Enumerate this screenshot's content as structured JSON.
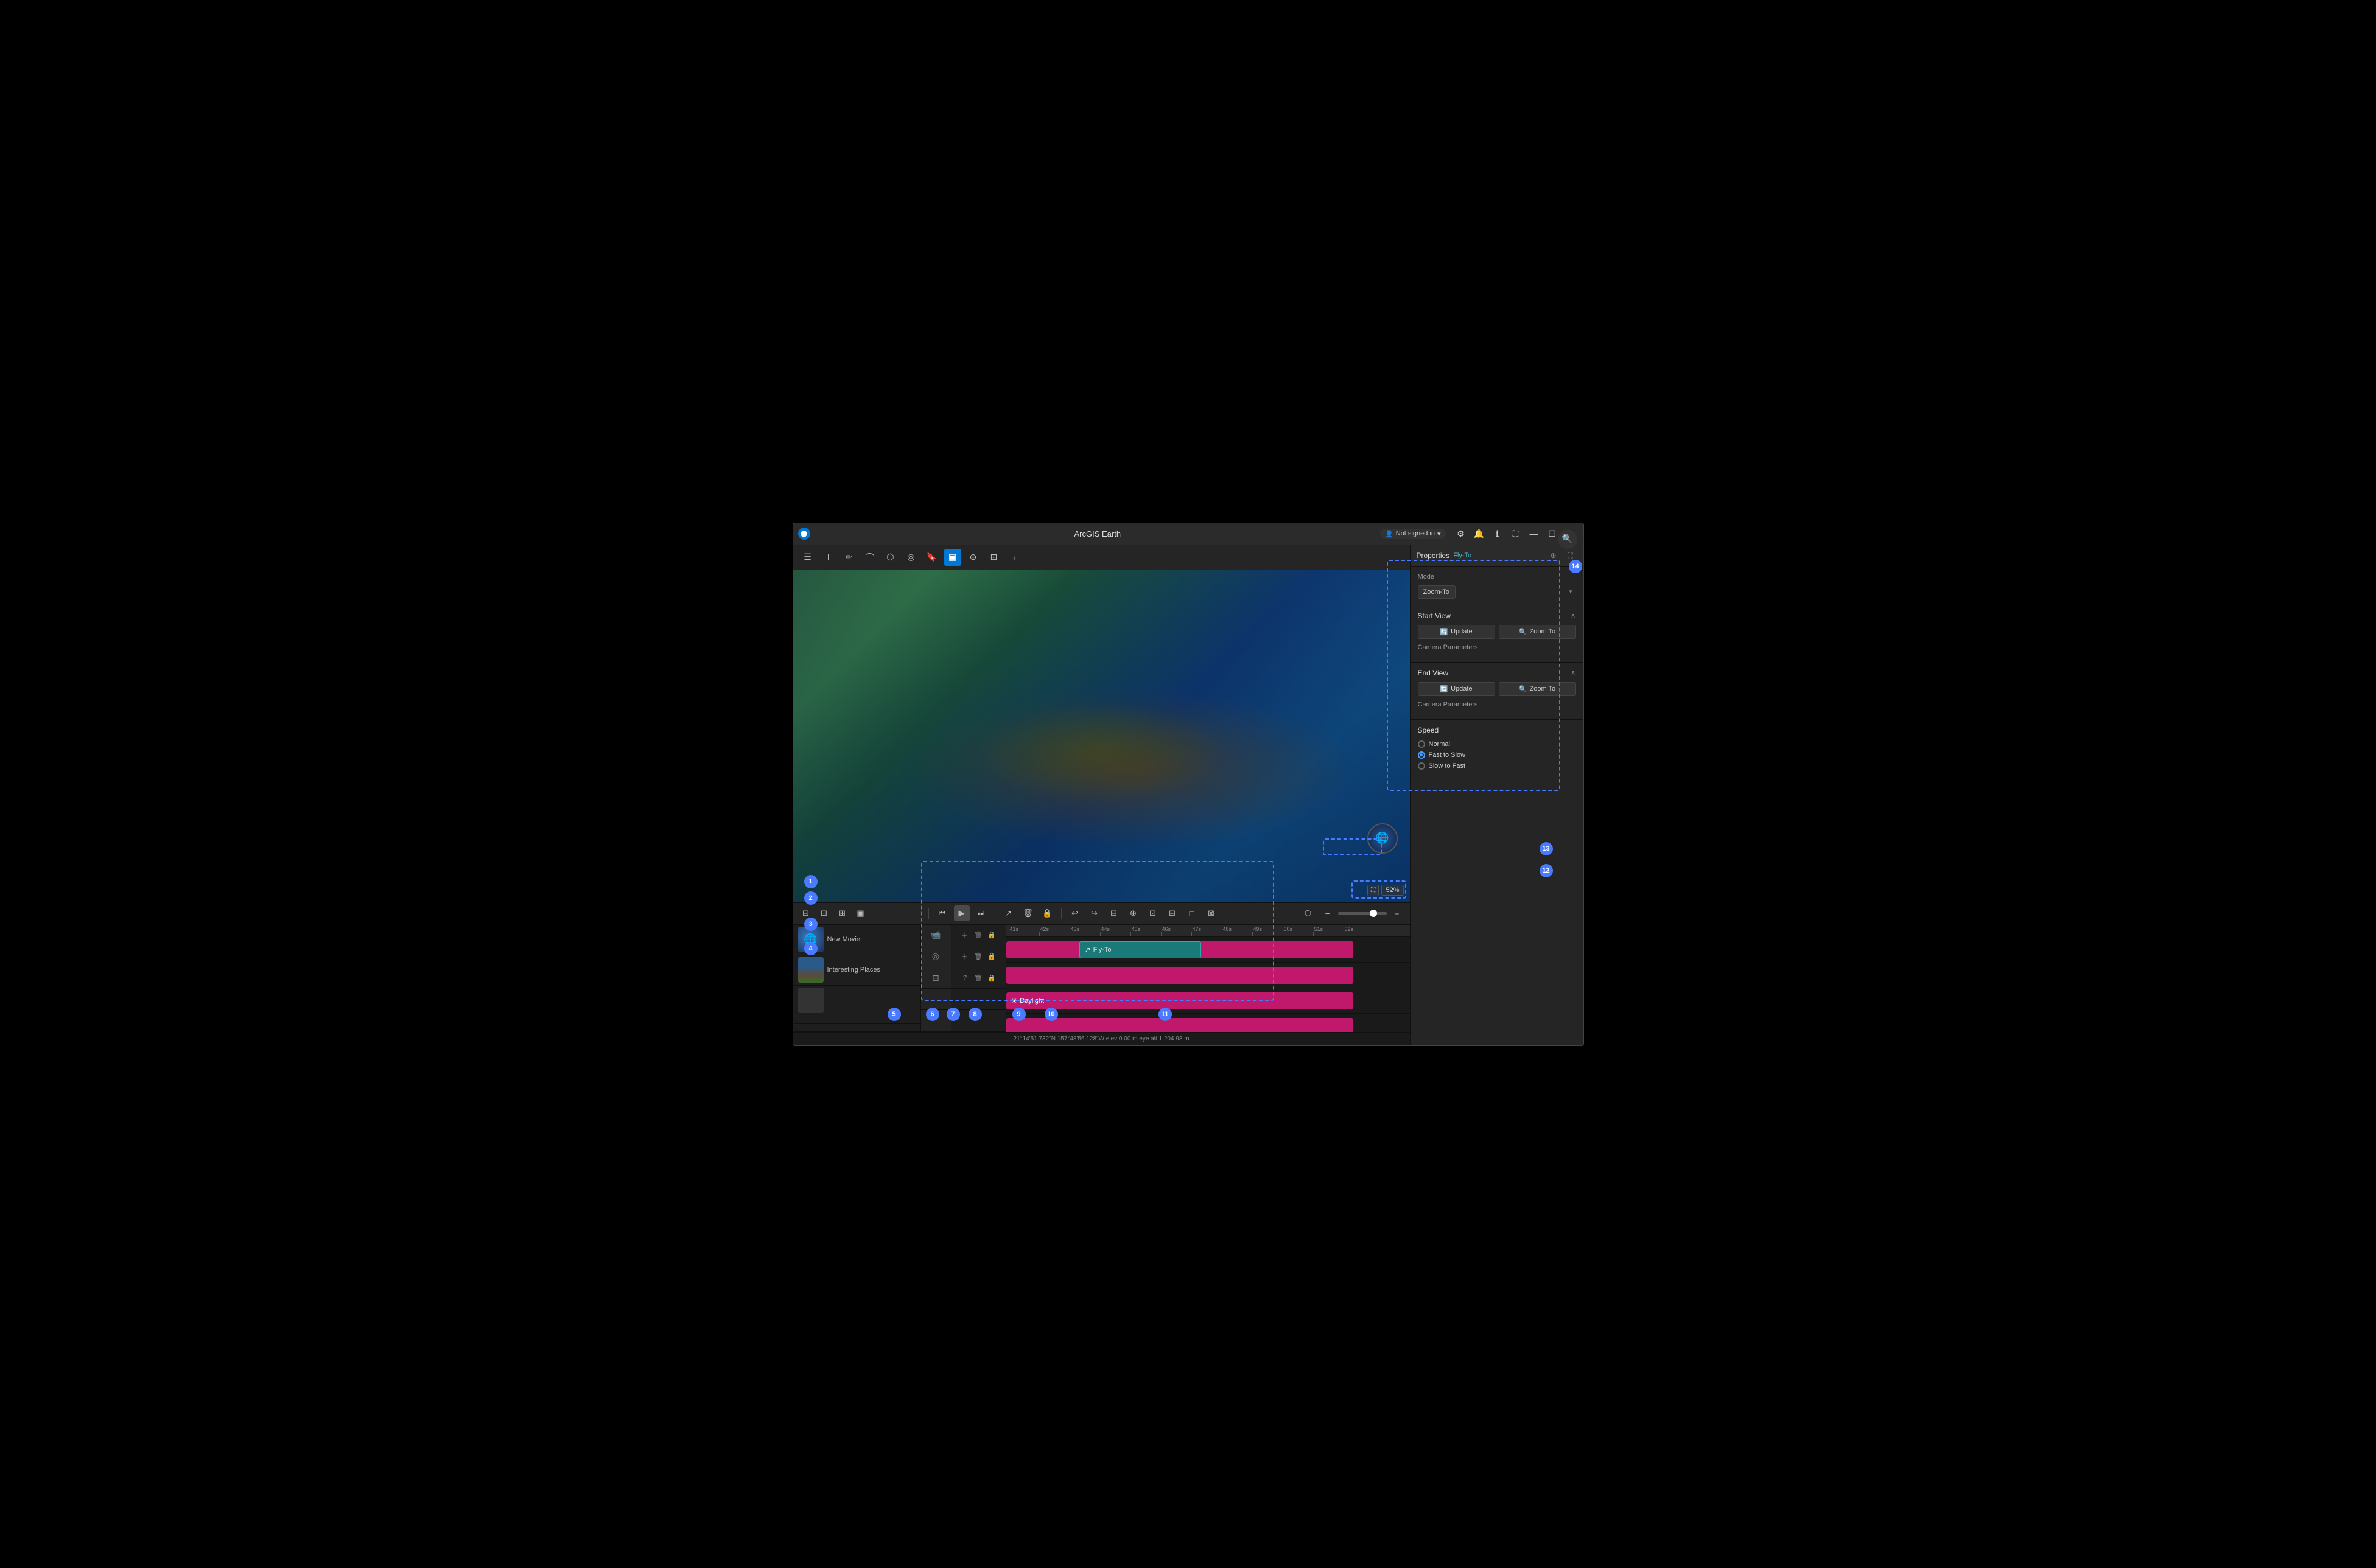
{
  "window": {
    "title": "ArcGIS Earth",
    "icon": "⬤"
  },
  "titlebar": {
    "user_label": "Not signed in",
    "settings_btn": "⚙",
    "bell_btn": "🔔",
    "info_btn": "ℹ",
    "expand_btn": "⛶",
    "minimize_btn": "—",
    "restore_btn": "☐",
    "close_btn": "✕"
  },
  "toolbar": {
    "list_btn": "☰",
    "add_btn": "+",
    "draw_btn": "✏",
    "erase_btn": "⌫",
    "shapes_btn": "⬡",
    "layers_btn": "◎",
    "bookmark_btn": "⬛",
    "movie_btn": "▣",
    "globe_btn": "⊕",
    "grid_btn": "⊞",
    "collapse_btn": "‹",
    "search_btn": "🔍"
  },
  "viewport": {
    "zoom_level": "52%",
    "compass_icon": "🌐",
    "fit_btn": "⛶",
    "zoom_icon": "↕"
  },
  "timeline": {
    "rewind_btn": "⏮",
    "play_btn": "⏵",
    "forward_btn": "⏭",
    "undo_btn": "↩",
    "redo_btn": "↪",
    "tools": [
      "⊟",
      "⊕",
      "⊡",
      "⊞",
      "□",
      "⊠"
    ],
    "ruler_marks": [
      "41s",
      "42s",
      "43s",
      "44s",
      "45s",
      "46s",
      "47s",
      "48s",
      "49s",
      "50s",
      "51s",
      "52s"
    ],
    "zoom_minus": "−",
    "zoom_plus": "+",
    "share_btn": "↗",
    "delete_btn": "🗑",
    "lock_btn": "🔒",
    "question_btn": "?"
  },
  "tracks": [
    {
      "id": "new-movie",
      "label": "New Movie",
      "type": "globe"
    },
    {
      "id": "interesting-places",
      "label": "Interesting Places",
      "type": "mountain"
    },
    {
      "id": "untitled",
      "label": "",
      "type": "gray"
    }
  ],
  "clips": [
    {
      "id": "fly-to",
      "label": "Fly-To",
      "color": "teal",
      "icon": "↗",
      "row": 0
    },
    {
      "id": "pink-bar-1",
      "label": "",
      "color": "pink",
      "row": 0
    },
    {
      "id": "daylight",
      "label": "Daylight",
      "color": "pink",
      "icon": "☀",
      "row": 1
    },
    {
      "id": "pink-bar-2",
      "label": "",
      "color": "pink",
      "row": 2
    },
    {
      "id": "purple-bar",
      "label": "",
      "color": "purple",
      "row": 3
    }
  ],
  "properties": {
    "title": "Properties",
    "tab": "Fly-To",
    "mode_label": "Mode",
    "mode_value": "Zoom-To",
    "start_view_label": "Start View",
    "update_btn": "Update",
    "zoom_to_btn": "Zoom To",
    "camera_params_1": "Camera Parameters",
    "end_view_label": "End View",
    "camera_params_2": "Camera Parameters",
    "speed_label": "Speed",
    "speed_options": [
      {
        "id": "normal",
        "label": "Normal",
        "checked": false
      },
      {
        "id": "fast-to-slow",
        "label": "Fast to Slow",
        "checked": true
      },
      {
        "id": "slow-to-fast",
        "label": "Slow to Fast",
        "checked": false
      }
    ]
  },
  "coordinates": {
    "text": "21°14'51.732\"N 157°48'56.128\"W  elev 0.00 m  eye alt 1,204.98 m"
  },
  "badges": [
    {
      "id": "1",
      "label": "1"
    },
    {
      "id": "2",
      "label": "2"
    },
    {
      "id": "3",
      "label": "3"
    },
    {
      "id": "4",
      "label": "4"
    },
    {
      "id": "5",
      "label": "5"
    },
    {
      "id": "6",
      "label": "6"
    },
    {
      "id": "7",
      "label": "7"
    },
    {
      "id": "8",
      "label": "8"
    },
    {
      "id": "9",
      "label": "9"
    },
    {
      "id": "10",
      "label": "10"
    },
    {
      "id": "11",
      "label": "11"
    },
    {
      "id": "12",
      "label": "12"
    },
    {
      "id": "13",
      "label": "13"
    },
    {
      "id": "14",
      "label": "14"
    }
  ]
}
